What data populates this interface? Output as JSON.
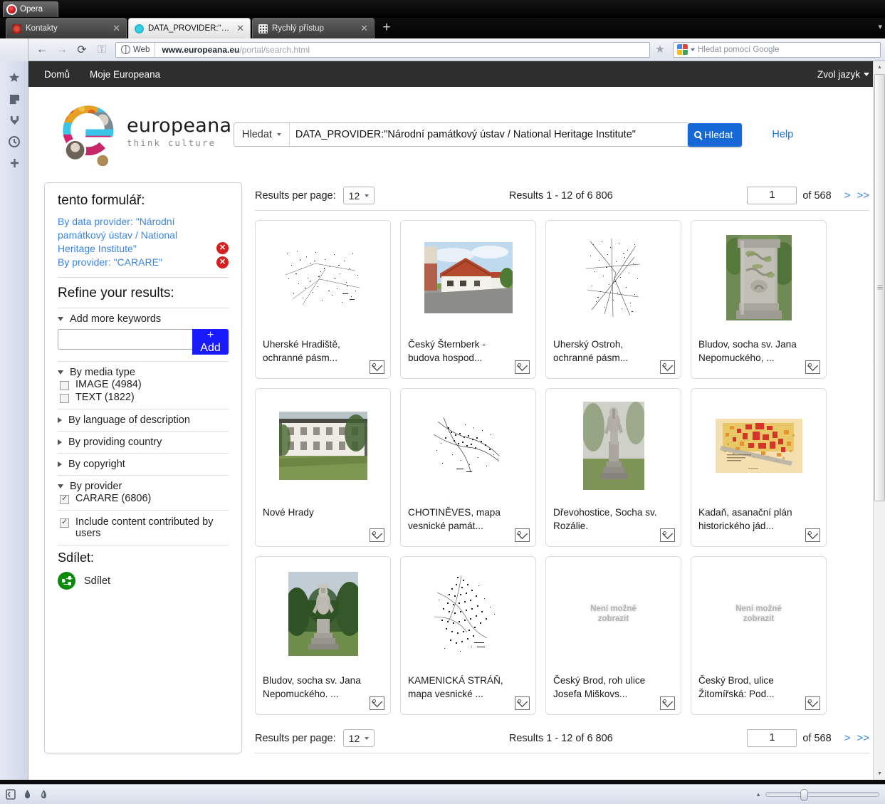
{
  "browser": {
    "app_name": "Opera",
    "tabs": [
      {
        "label": "Kontakty",
        "favicon_color": "#c7332c",
        "active": false
      },
      {
        "label": "DATA_PROVIDER:\"Nár...",
        "favicon_color": "#22c0d8",
        "active": true
      },
      {
        "label": "Rychlý přístup",
        "favicon_color": "#4a4a4a",
        "active": false
      }
    ],
    "new_tab_label": "+",
    "tab_menu_icon": "chevron-down-icon",
    "nav": {
      "back_icon": "arrow-left-icon",
      "forward_icon": "arrow-right-icon",
      "reload_icon": "reload-icon",
      "key_icon": "key-icon"
    },
    "url_badge": "Web",
    "url_host": "www.europeana.eu",
    "url_path": "/portal/search.html",
    "bookmark_icon": "star-icon",
    "search_placeholder": "Hledat pomocí Google",
    "sidebar_icons": [
      "star-icon",
      "notes-icon",
      "downloads-icon",
      "history-clock-icon",
      "plus-icon"
    ],
    "status_icons": [
      "panel-toggle-icon",
      "cloud-icon",
      "cloud-sync-icon"
    ],
    "zoom_level": "100%"
  },
  "site": {
    "topnav": {
      "home": "Domů",
      "my_europeana": "Moje Europeana",
      "language": "Zvol jazyk"
    },
    "logo": {
      "wordmark": "europeana",
      "tagline": "think culture"
    },
    "search": {
      "scope_label": "Hledat",
      "query": "DATA_PROVIDER:\"Národní památkový ústav / National Heritage Institute\"",
      "button_label": "Hledat",
      "help_label": "Help"
    }
  },
  "facets": {
    "active_heading": "tento formulář:",
    "active_criteria": [
      {
        "label": "By data provider: \"Národní památkový ústav / National Heritage Institute\""
      },
      {
        "label": "By provider: \"CARARE\""
      }
    ],
    "refine_heading": "Refine your results:",
    "keywords": {
      "toggle_label": "Add more keywords",
      "input_value": "",
      "add_label": "+ Add"
    },
    "groups": [
      {
        "label": "By media type",
        "expanded": true,
        "items": [
          {
            "label": "IMAGE (4984)",
            "checked": false
          },
          {
            "label": "TEXT (1822)",
            "checked": false
          }
        ]
      },
      {
        "label": "By language of description",
        "expanded": false,
        "items": []
      },
      {
        "label": "By providing country",
        "expanded": false,
        "items": []
      },
      {
        "label": "By copyright",
        "expanded": false,
        "items": []
      },
      {
        "label": "By provider",
        "expanded": true,
        "items": [
          {
            "label": "CARARE (6806)",
            "checked": true
          }
        ]
      }
    ],
    "include_user_content": {
      "label": "Include content contributed by users",
      "checked": true
    },
    "share_heading": "Sdílet:",
    "share_label": "Sdílet"
  },
  "pagination": {
    "per_page_label": "Results per page:",
    "per_page_value": "12",
    "results_label": "Results  1 - 12 of 6 806",
    "page_value": "1",
    "of_label": "of 568",
    "next_label": ">",
    "last_label": ">>"
  },
  "results": [
    {
      "title": "Uherské Hradiště, ochranné pásm...",
      "thumb": "map-dots-wide",
      "type_icon": "image-type-icon"
    },
    {
      "title": "Český Šternberk - budova hospod...",
      "thumb": "photo-cottage",
      "type_icon": "image-type-icon"
    },
    {
      "title": "Uherský Ostroh, ochranné pásm...",
      "thumb": "map-dots-tall",
      "type_icon": "image-type-icon"
    },
    {
      "title": "Bludov, socha sv. Jana Nepomuckého, ...",
      "thumb": "photo-stone-pedestal",
      "type_icon": "image-type-icon"
    },
    {
      "title": "Nové Hrady",
      "thumb": "photo-white-building",
      "type_icon": "image-type-icon"
    },
    {
      "title": "CHOTINĚVES, mapa vesnické památ...",
      "thumb": "map-sketch",
      "type_icon": "image-type-icon"
    },
    {
      "title": "Dřevohostice, Socha sv. Rozálie.",
      "thumb": "photo-statue-column",
      "type_icon": "image-type-icon"
    },
    {
      "title": "Kadaň, asanační plán historického jád...",
      "thumb": "map-cadastral-red",
      "type_icon": "image-type-icon"
    },
    {
      "title": "Bludov, socha sv. Jana Nepomuckého. ...",
      "thumb": "photo-statue-garden",
      "type_icon": "image-type-icon"
    },
    {
      "title": "KAMENICKÁ STRÁŇ, mapa vesnické ...",
      "thumb": "map-dots-cluster",
      "type_icon": "image-type-icon"
    },
    {
      "title": "Český Brod, roh ulice Josefa Miškovs...",
      "thumb": "unavailable",
      "type_icon": "image-type-icon"
    },
    {
      "title": "Český Brod, ulice Žitomířská: Pod...",
      "thumb": "unavailable",
      "type_icon": "image-type-icon"
    }
  ],
  "unavailable_text_line1": "Není možné",
  "unavailable_text_line2": "zobrazit",
  "colors": {
    "accent_blue": "#1569d6",
    "link_blue": "#3b86e0",
    "delete_red": "#d61f1f",
    "add_blue": "#1a1aff",
    "share_green": "#0a8a0a",
    "topbar_dark": "#2e2e2e"
  }
}
